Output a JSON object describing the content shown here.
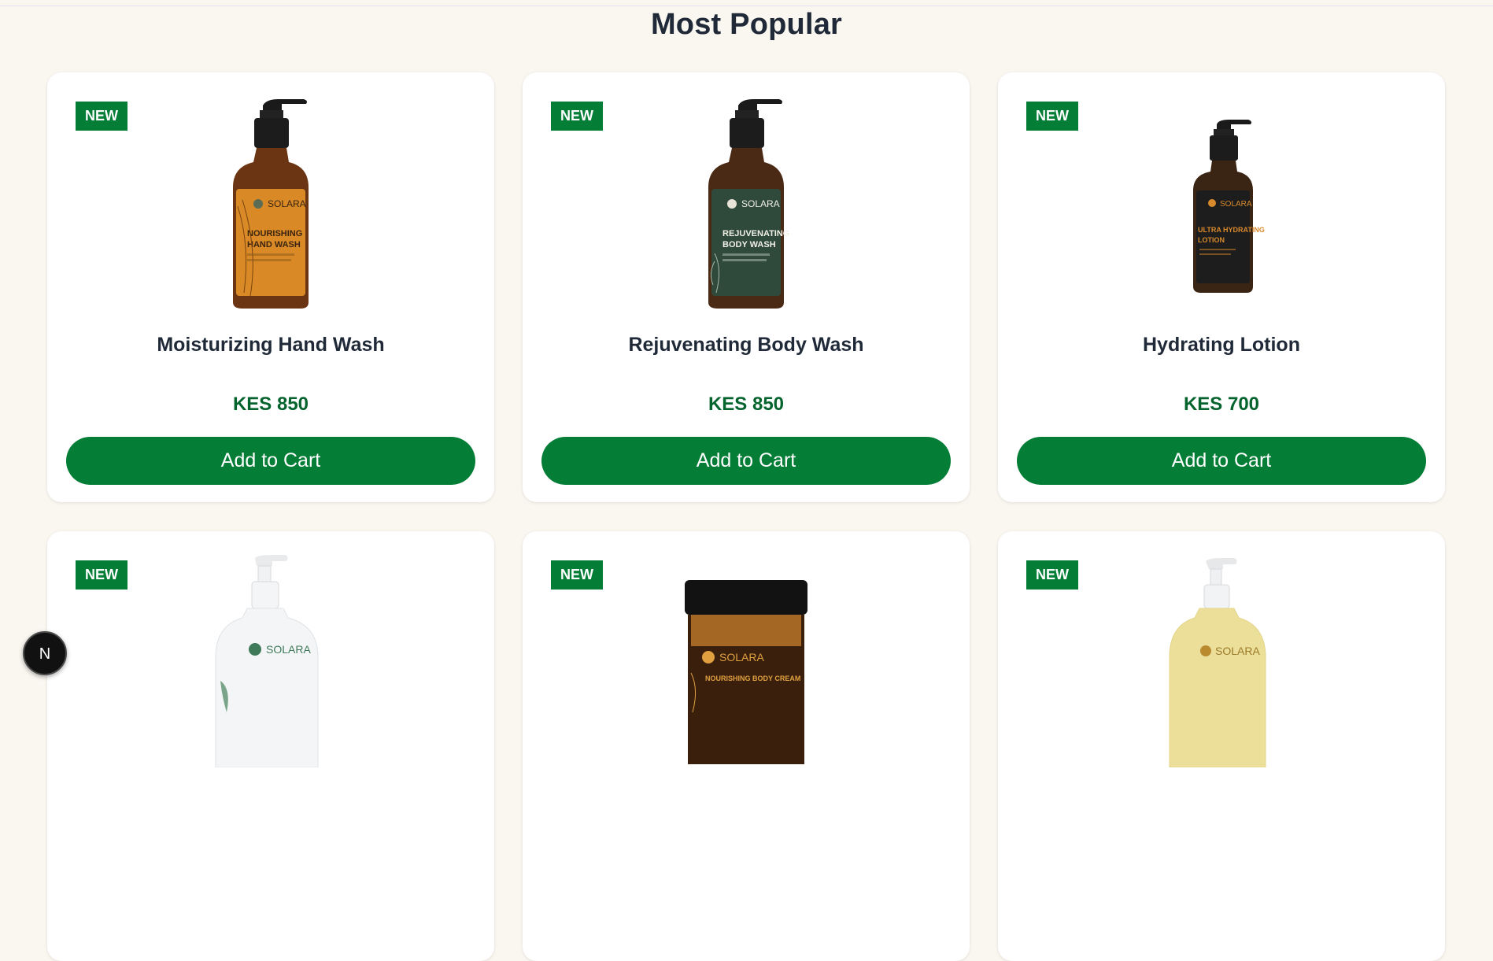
{
  "section": {
    "title": "Most Popular"
  },
  "badge_label": "NEW",
  "products": [
    {
      "name": "Moisturizing Hand Wash",
      "price": "KES 850",
      "cta": "Add to Cart",
      "image": {
        "type": "pump-bottle",
        "label_line1": "NOURISHING",
        "label_line2": "HAND WASH",
        "brand": "SOLARA",
        "label_color": "#d98a26",
        "text_color": "#3a2410",
        "body_color": "#6b3412"
      }
    },
    {
      "name": "Rejuvenating Body Wash",
      "price": "KES 850",
      "cta": "Add to Cart",
      "image": {
        "type": "pump-bottle",
        "label_line1": "REJUVENATING",
        "label_line2": "BODY WASH",
        "brand": "SOLARA",
        "label_color": "#2f4a3a",
        "text_color": "#f1efe6",
        "body_color": "#4a2a14"
      }
    },
    {
      "name": "Hydrating Lotion",
      "price": "KES 700",
      "cta": "Add to Cart",
      "image": {
        "type": "pump-bottle-small",
        "label_line1": "ULTRA HYDRATING",
        "label_line2": "LOTION",
        "brand": "SOLARA",
        "label_color": "#1d1d1d",
        "text_color": "#d8892c",
        "body_color": "#3a2414"
      }
    },
    {
      "name": "",
      "price": "",
      "cta": "",
      "image": {
        "type": "white-pump-bottle",
        "brand": "SOLARA"
      }
    },
    {
      "name": "",
      "price": "",
      "cta": "",
      "image": {
        "type": "jar",
        "brand": "SOLARA",
        "label_line1": "NOURISHING BODY CREAM"
      }
    },
    {
      "name": "",
      "price": "",
      "cta": "",
      "image": {
        "type": "cream-pump-bottle",
        "brand": "SOLARA"
      }
    }
  ],
  "framework_badge": {
    "letter": "N"
  }
}
